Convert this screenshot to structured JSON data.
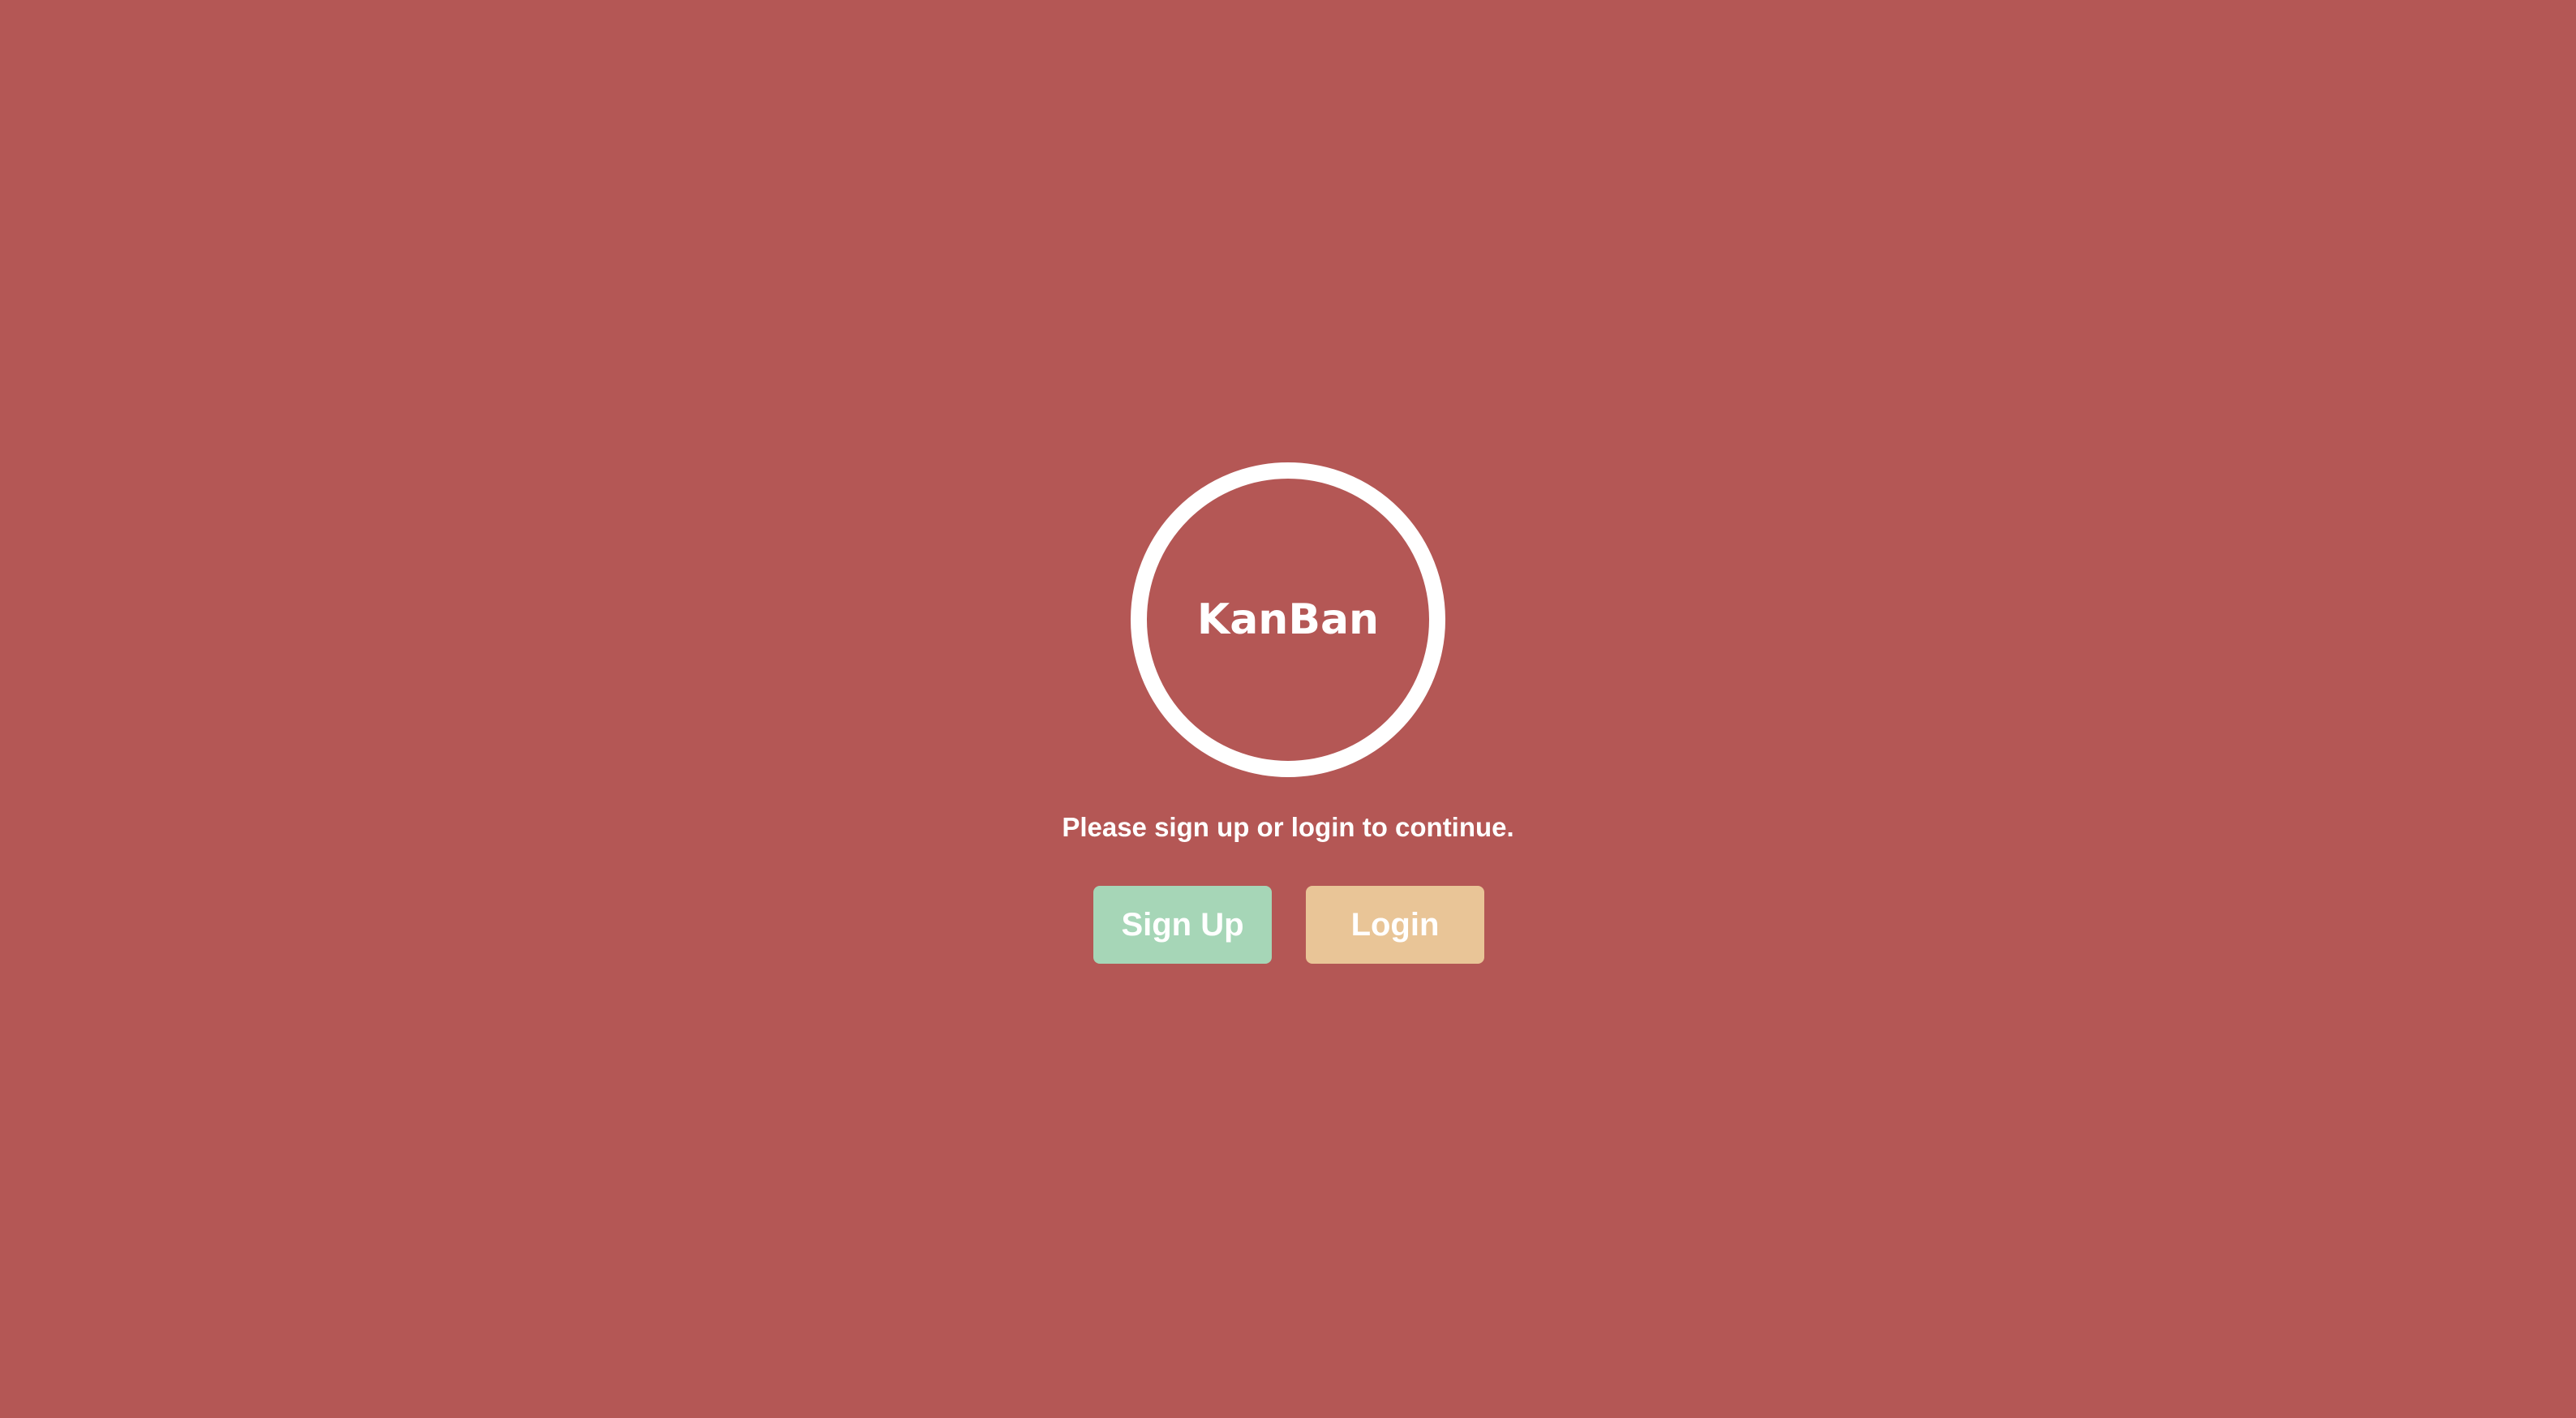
{
  "logo": {
    "text": "KanBan"
  },
  "prompt": {
    "text": "Please sign up or login to continue."
  },
  "buttons": {
    "signup_label": "Sign Up",
    "login_label": "Login"
  },
  "colors": {
    "background": "#b45755",
    "logo_ring": "#ffffff",
    "signup_button": "#a6d6b7",
    "login_button": "#e9c597",
    "text": "#ffffff"
  }
}
